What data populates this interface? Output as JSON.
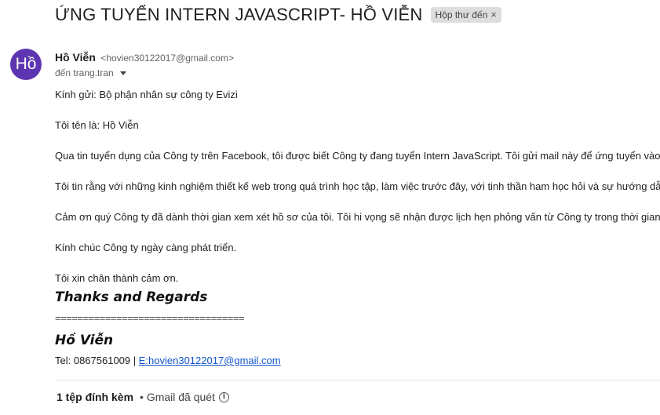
{
  "email": {
    "subject": "ỨNG TUYỂN INTERN JAVASCRIPT- HỒ VIỄN",
    "label": "Hộp thư đến",
    "label_remove_glyph": "×",
    "avatar_text": "Hồ",
    "sender_name": "Hồ Viễn",
    "sender_email": "<hovien30122017@gmail.com>",
    "recipient": "đến trang.tran"
  },
  "body": {
    "greeting": "Kính gửi: Bộ phận nhân sự công ty  Evizi",
    "intro": "Tôi tên là: Hồ Viễn",
    "para1": "Qua tin tuyển dụng của Công ty trên Facebook, tôi được biết Công ty đang tuyển Intern JavaScript. Tôi gửi mail này để ứng tuyển vào",
    "para2": "Tôi tin rằng với những kinh nghiệm thiết kế web trong quá trình học tập, làm việc trước đây, với tinh thần ham học hỏi và sự hướng dẫ",
    "para3": "Cảm ơn quý Công ty đã dành thời gian xem xét hồ sơ của tôi. Tôi hi vọng sẽ nhận được lịch hẹn phỏng vấn từ Công ty trong thời gian",
    "wish": "Kính chúc Công ty ngày càng phát triển.",
    "thanks": "Tôi xin chân thành cảm ơn."
  },
  "signature": {
    "regards": "Thanks and Regards",
    "divider": "==================================",
    "name": "Hồ Viễn",
    "tel_prefix": "Tel: 0867561009 | ",
    "email_link": "E:hovien30122017@gmail.com"
  },
  "attachments": {
    "count_label": "1 tệp đính kèm",
    "scan_label": "• Gmail đã quét",
    "info_glyph": "i"
  }
}
